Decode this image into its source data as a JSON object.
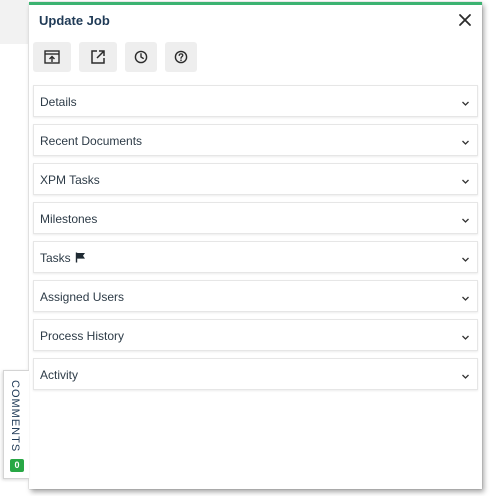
{
  "window": {
    "title": "Update Job",
    "accent_color": "#3cb371"
  },
  "toolbar": {
    "buttons": [
      {
        "icon": "upload-window-icon"
      },
      {
        "icon": "external-link-icon"
      },
      {
        "icon": "clock-icon"
      },
      {
        "icon": "help-icon"
      }
    ]
  },
  "sections": [
    {
      "label": "Details"
    },
    {
      "label": "Recent Documents"
    },
    {
      "label": "XPM Tasks"
    },
    {
      "label": "Milestones"
    },
    {
      "label": "Tasks",
      "icon": "flag-icon"
    },
    {
      "label": "Assigned Users"
    },
    {
      "label": "Process History"
    },
    {
      "label": "Activity"
    }
  ],
  "comments": {
    "label": "COMMENTS",
    "count": "0",
    "badge_color": "#28a745"
  }
}
